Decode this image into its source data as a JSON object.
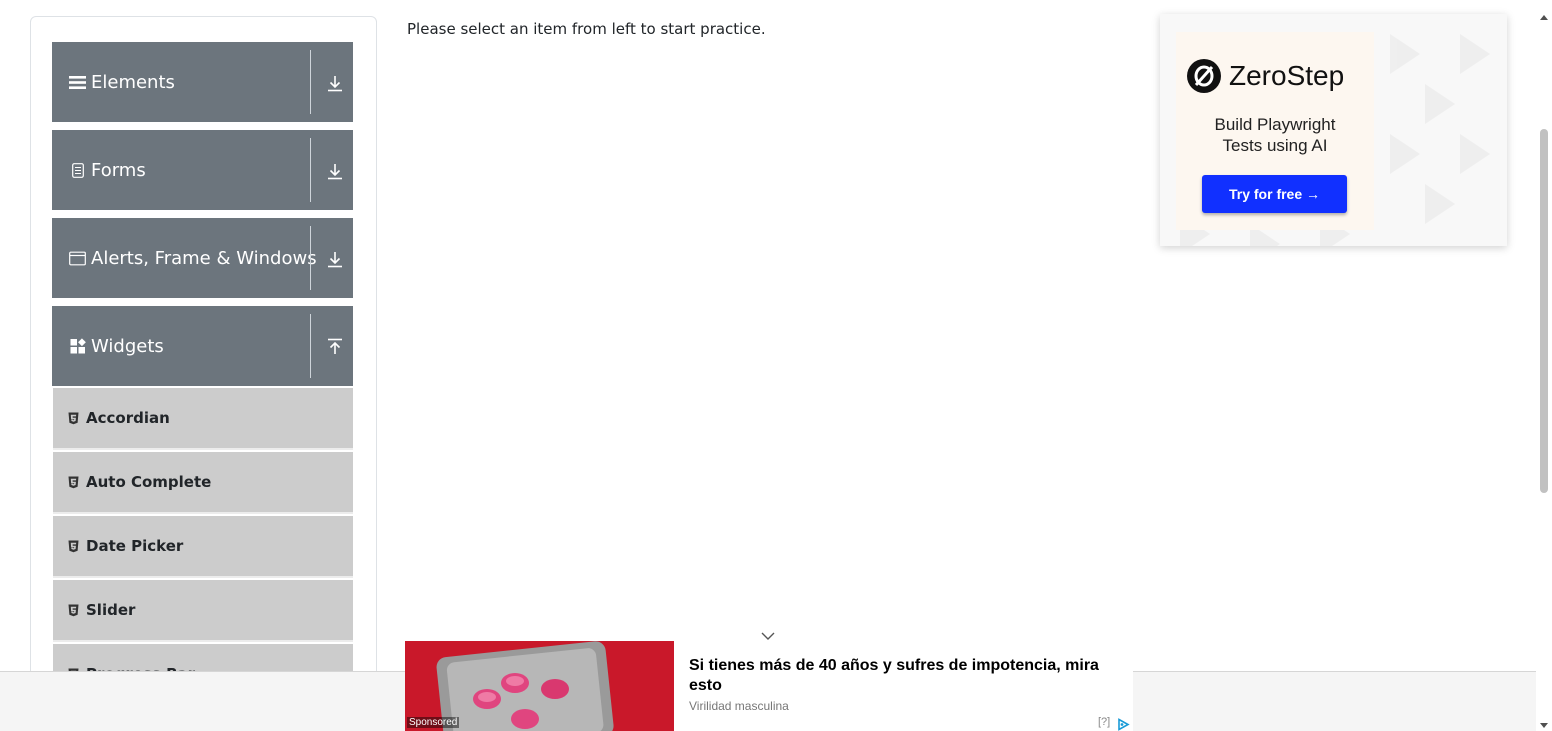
{
  "sidebar": {
    "groups": [
      {
        "label": "Elements",
        "icon": "list-icon",
        "expanded": false
      },
      {
        "label": "Forms",
        "icon": "document-icon",
        "expanded": false
      },
      {
        "label": "Alerts, Frame & Windows",
        "icon": "window-icon",
        "expanded": false
      },
      {
        "label": "Widgets",
        "icon": "widgets-icon",
        "expanded": true
      }
    ],
    "widgets_items": [
      {
        "label": "Accordian",
        "icon": "html5-icon"
      },
      {
        "label": "Auto Complete",
        "icon": "html5-icon"
      },
      {
        "label": "Date Picker",
        "icon": "html5-icon"
      },
      {
        "label": "Slider",
        "icon": "html5-icon"
      },
      {
        "label": "Progress Bar",
        "icon": "html5-icon"
      }
    ]
  },
  "main": {
    "instruction": "Please select an item from left to start practice."
  },
  "ad_right": {
    "brand": "ZeroStep",
    "tagline_line1": "Build Playwright",
    "tagline_line2": "Tests using AI",
    "button_label": "Try for free →",
    "button_color": "#1130ff"
  },
  "ad_bottom": {
    "title": "Si tienes más de 40 años y sufres de impotencia, mira esto",
    "source": "Virilidad masculina",
    "sponsored_label": "Sponsored",
    "help_label": "[?]"
  },
  "colors": {
    "group_header_bg": "#6c757d",
    "sub_item_bg": "#cccccc"
  }
}
